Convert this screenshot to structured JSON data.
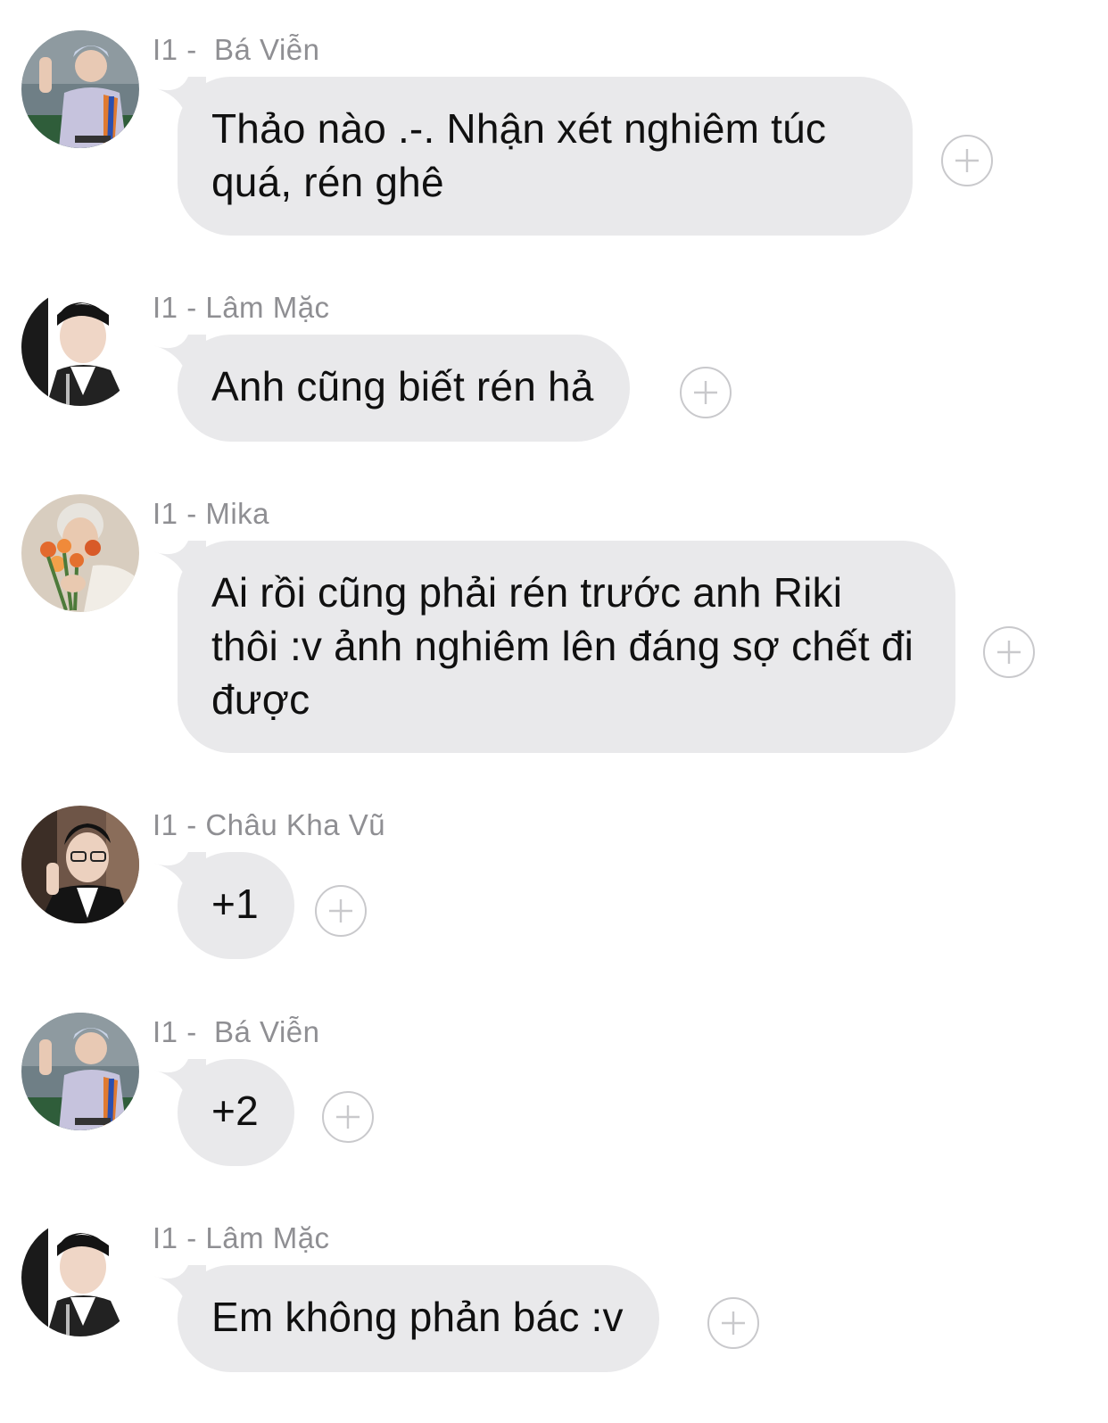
{
  "messages": [
    {
      "sender": "I1 -  Bá Viễn",
      "text": "Thảo nào .-. Nhận xét nghiêm túc quá, rén ghê",
      "avatar": "avatar-ba-vien",
      "action_icon": "plus-circle-icon"
    },
    {
      "sender": "I1 - Lâm Mặc",
      "text": "Anh cũng biết rén hả",
      "avatar": "avatar-lam-mac",
      "action_icon": "plus-circle-icon"
    },
    {
      "sender": "I1 - Mika",
      "text": "Ai rồi cũng phải rén trước anh Riki thôi :v ảnh nghiêm lên đáng sợ chết đi được",
      "avatar": "avatar-mika",
      "action_icon": "plus-circle-icon"
    },
    {
      "sender": "I1 - Châu Kha Vũ",
      "text": "+1",
      "avatar": "avatar-chau-kha-vu",
      "action_icon": "plus-circle-icon"
    },
    {
      "sender": "I1 -  Bá Viễn",
      "text": "+2",
      "avatar": "avatar-ba-vien",
      "action_icon": "plus-circle-icon"
    },
    {
      "sender": "I1 - Lâm Mặc",
      "text": "Em không phản bác :v",
      "avatar": "avatar-lam-mac",
      "action_icon": "plus-circle-icon"
    }
  ],
  "colors": {
    "bubble": "#e9e9eb",
    "sender_name": "#8f8f93",
    "message_text": "#101010",
    "react_button_border": "#c9c9cc"
  }
}
